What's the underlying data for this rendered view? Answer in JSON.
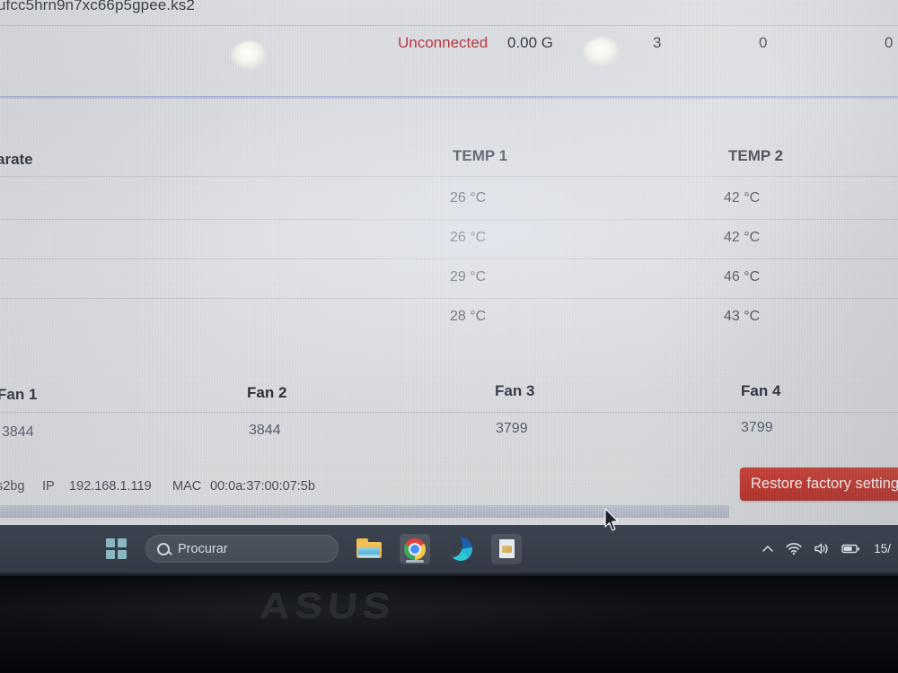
{
  "browser": {
    "url_text": "ufcc5hrn9n7xc66p5gpee.ks2"
  },
  "miner_status": {
    "connection": "Unconnected",
    "hashrate": "0.00 G",
    "value_3": "3",
    "value_0a": "0",
    "value_0b": "0"
  },
  "temperature_table": {
    "headers": {
      "rate": "arate",
      "temp1": "TEMP 1",
      "temp2": "TEMP 2"
    },
    "rows": [
      {
        "temp1": "26 °C",
        "temp2": "42 °C"
      },
      {
        "temp1": "26 °C",
        "temp2": "42 °C"
      },
      {
        "temp1": "29 °C",
        "temp2": "46 °C"
      },
      {
        "temp1": "28 °C",
        "temp2": "43 °C"
      }
    ]
  },
  "fan_table": {
    "headers": [
      "Fan 1",
      "Fan 2",
      "Fan 3",
      "Fan 4"
    ],
    "values": [
      "3844",
      "3844",
      "3799",
      "3799"
    ]
  },
  "status_bar": {
    "mode": "s2bg",
    "ip_label": "IP",
    "ip_value": "192.168.1.119",
    "mac_label": "MAC",
    "mac_value": "00:0a:37:00:07:5b",
    "restore_button": "Restore factory setting"
  },
  "taskbar": {
    "search_placeholder": "Procurar",
    "clock": "15/",
    "icons": [
      "start-windows-logo",
      "folder-file-explorer",
      "google-chrome",
      "microsoft-edge",
      "document-app"
    ]
  },
  "device": {
    "brand": "ASUS"
  },
  "colors": {
    "accent_red": "#b03038",
    "restore_button_red": "#b83027",
    "taskbar": "#39404c",
    "divider_blue": "#929ecd"
  }
}
